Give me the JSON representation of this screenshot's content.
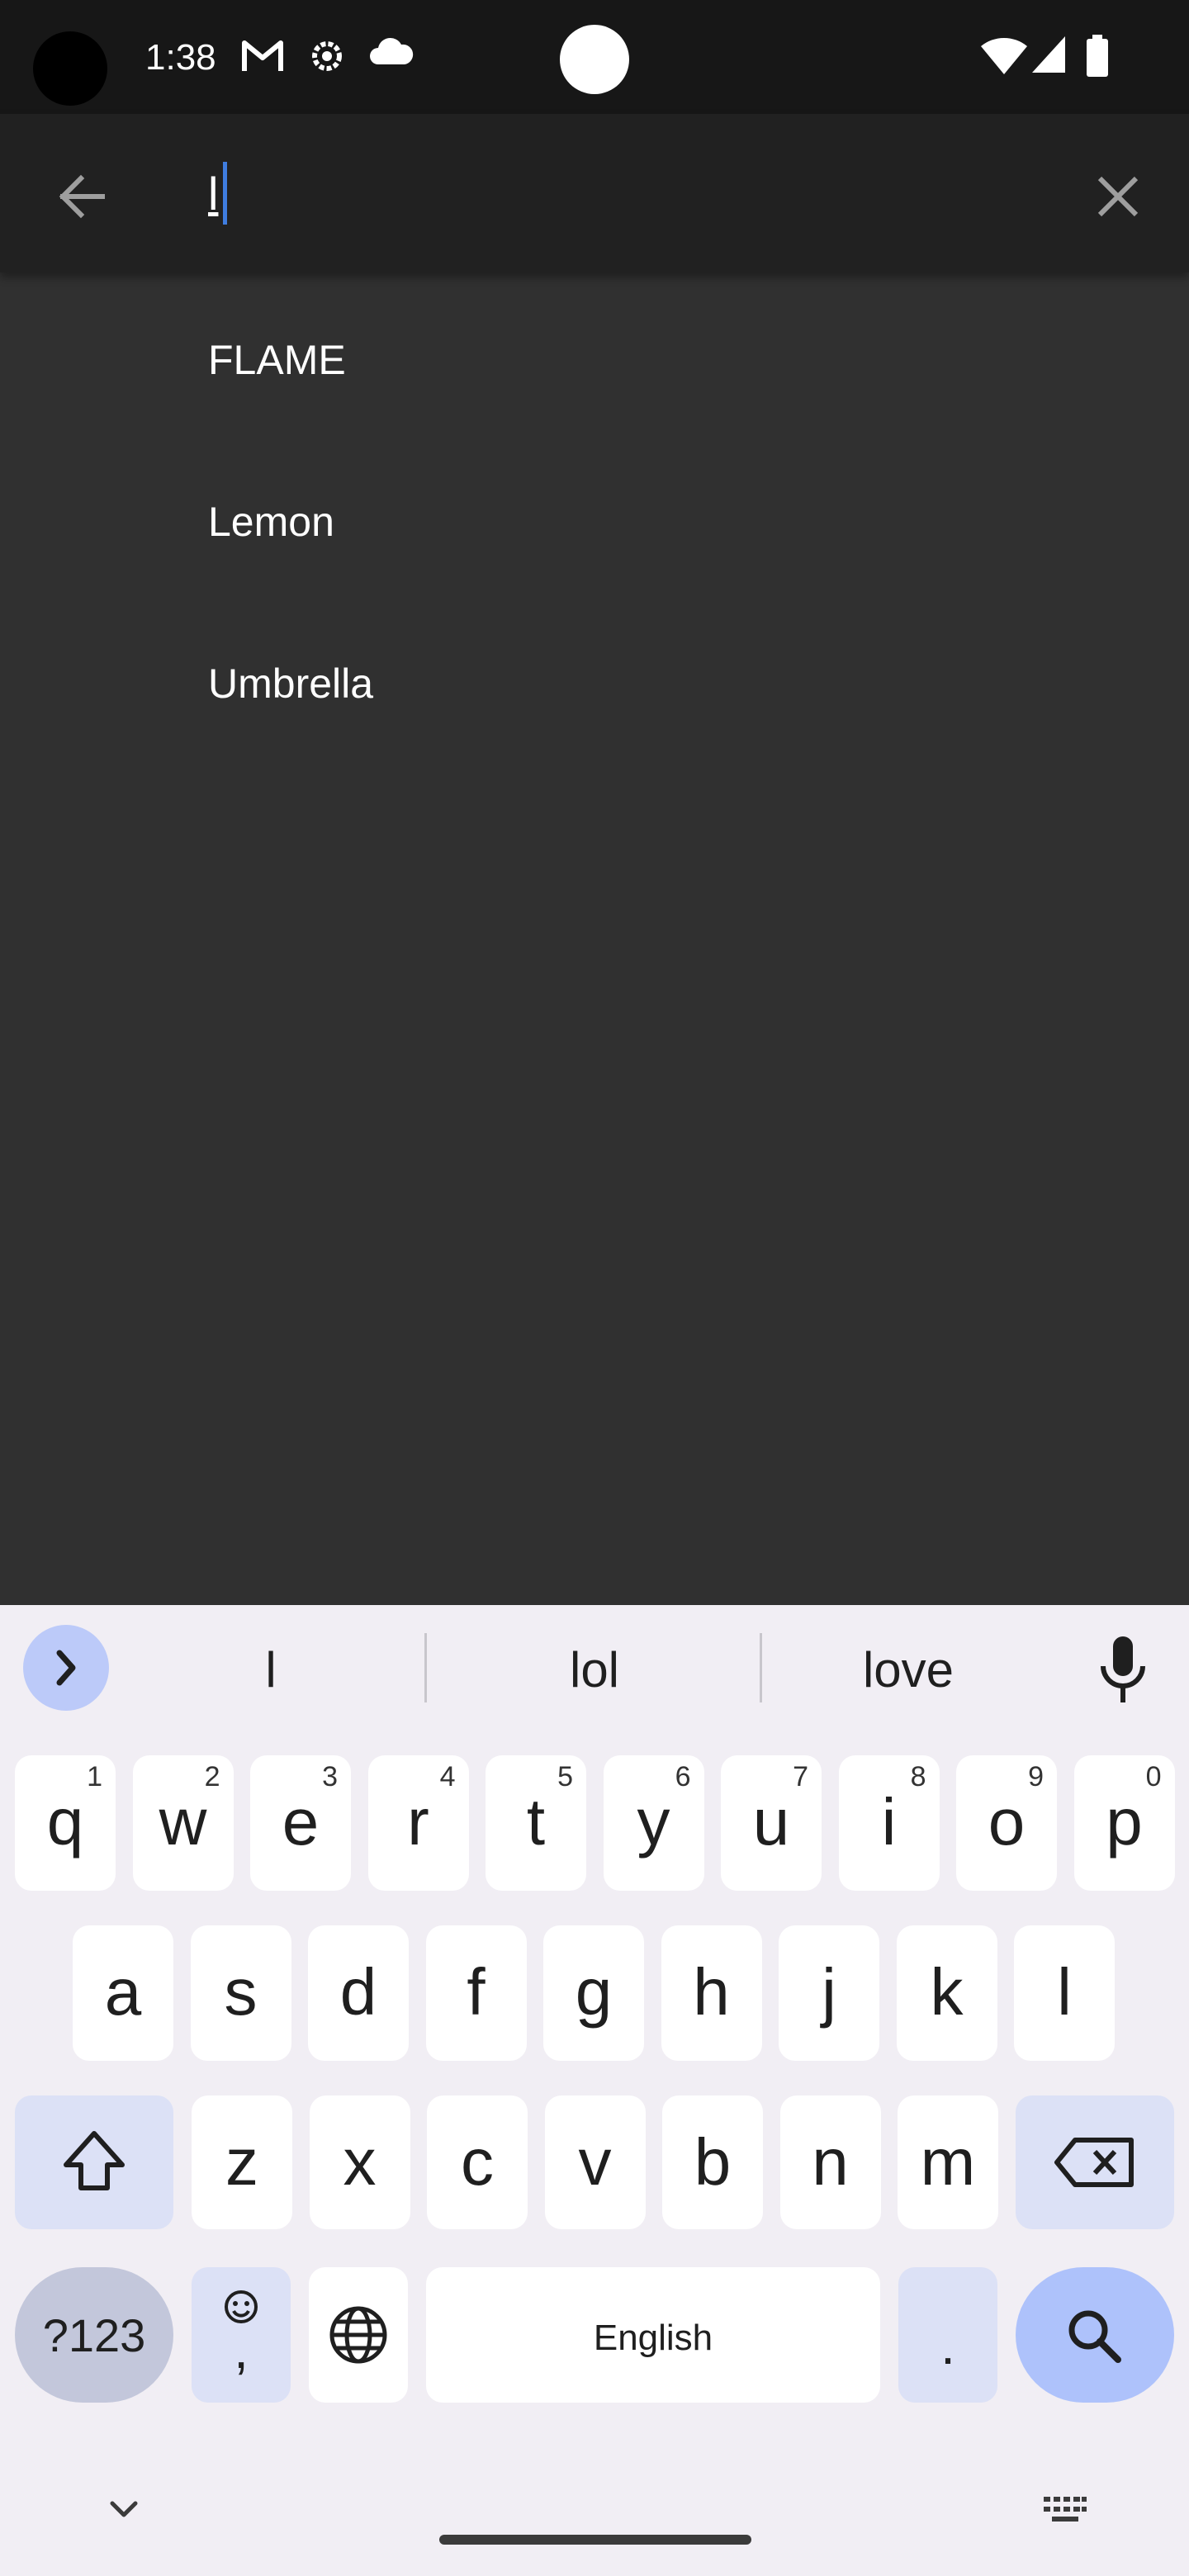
{
  "status_bar": {
    "time": "1:38",
    "icons": [
      "gmail-icon",
      "settings-icon",
      "cloud-icon",
      "wifi-icon",
      "signal-icon",
      "battery-icon"
    ]
  },
  "search": {
    "query": "l",
    "back_icon": "arrow-left-icon",
    "clear_icon": "close-icon"
  },
  "suggestions": [
    "FLAME",
    "Lemon",
    "Umbrella"
  ],
  "keyboard": {
    "predictions": [
      "l",
      "lol",
      "love"
    ],
    "row1": [
      {
        "k": "q",
        "n": "1"
      },
      {
        "k": "w",
        "n": "2"
      },
      {
        "k": "e",
        "n": "3"
      },
      {
        "k": "r",
        "n": "4"
      },
      {
        "k": "t",
        "n": "5"
      },
      {
        "k": "y",
        "n": "6"
      },
      {
        "k": "u",
        "n": "7"
      },
      {
        "k": "i",
        "n": "8"
      },
      {
        "k": "o",
        "n": "9"
      },
      {
        "k": "p",
        "n": "0"
      }
    ],
    "row2": [
      "a",
      "s",
      "d",
      "f",
      "g",
      "h",
      "j",
      "k",
      "l"
    ],
    "row3": [
      "z",
      "x",
      "c",
      "v",
      "b",
      "n",
      "m"
    ],
    "symbols_label": "?123",
    "emoji_comma_label": ",",
    "space_label": "English",
    "period_label": ".",
    "colors": {
      "accent": "#aec2fb",
      "function_key": "#dce1f6",
      "background": "#f1eef4"
    }
  }
}
